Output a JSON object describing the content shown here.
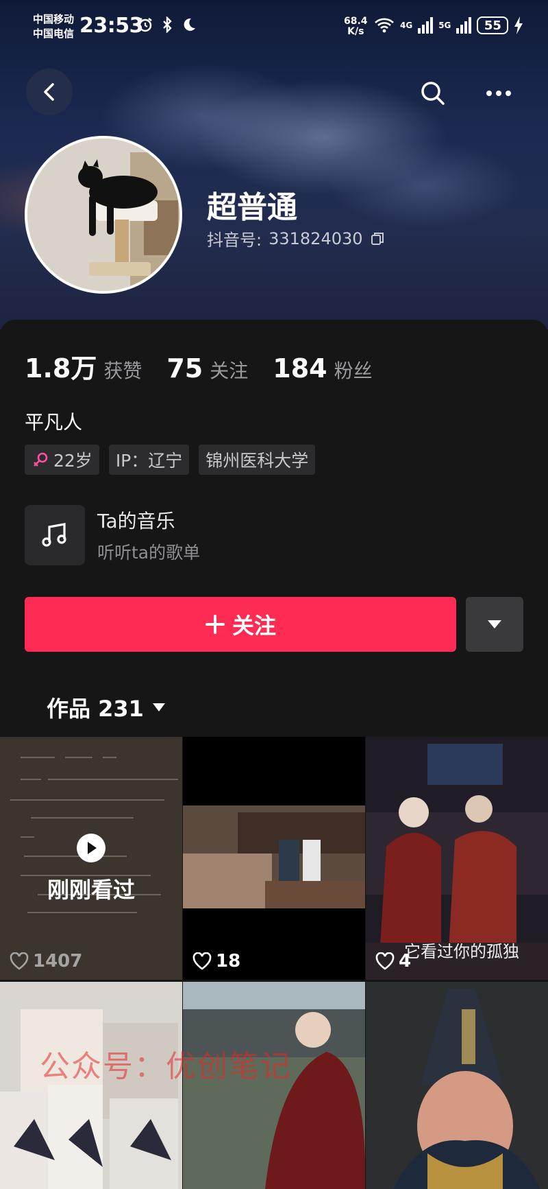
{
  "status_bar": {
    "carrier_1": "中国移动",
    "carrier_2": "中国电信",
    "time": "23:53",
    "net_speed_value": "68.4",
    "net_speed_unit": "K/s",
    "network_1": "4G",
    "network_2": "5G",
    "battery": "55",
    "icons": [
      "alarm-icon",
      "bluetooth-icon",
      "moon-icon",
      "wifi-icon",
      "signal-icon",
      "charging-icon"
    ]
  },
  "header": {
    "icons": [
      "back-icon",
      "search-icon",
      "more-icon"
    ]
  },
  "profile": {
    "nickname": "超普通",
    "douyin_id_label": "抖音号:",
    "douyin_id": "331824030",
    "stats": [
      {
        "value": "1.8万",
        "label": "获赞"
      },
      {
        "value": "75",
        "label": "关注"
      },
      {
        "value": "184",
        "label": "粉丝"
      }
    ],
    "bio": "平凡人",
    "tags": {
      "age": "22岁",
      "ip": "IP：辽宁",
      "school": "锦州医科大学"
    },
    "music": {
      "title": "Ta的音乐",
      "subtitle": "听听ta的歌单"
    },
    "follow_label": "关注",
    "accent_color": "#fe2c55"
  },
  "works": {
    "tab_label": "作品 231",
    "items": [
      {
        "likes": "1407",
        "badge": "刚刚看过"
      },
      {
        "likes": "18"
      },
      {
        "likes": "4",
        "overlay": "它看过你的孤独"
      },
      {
        "likes": ""
      },
      {
        "likes": ""
      },
      {
        "likes": ""
      }
    ]
  },
  "watermark": "公众号：优创笔记"
}
